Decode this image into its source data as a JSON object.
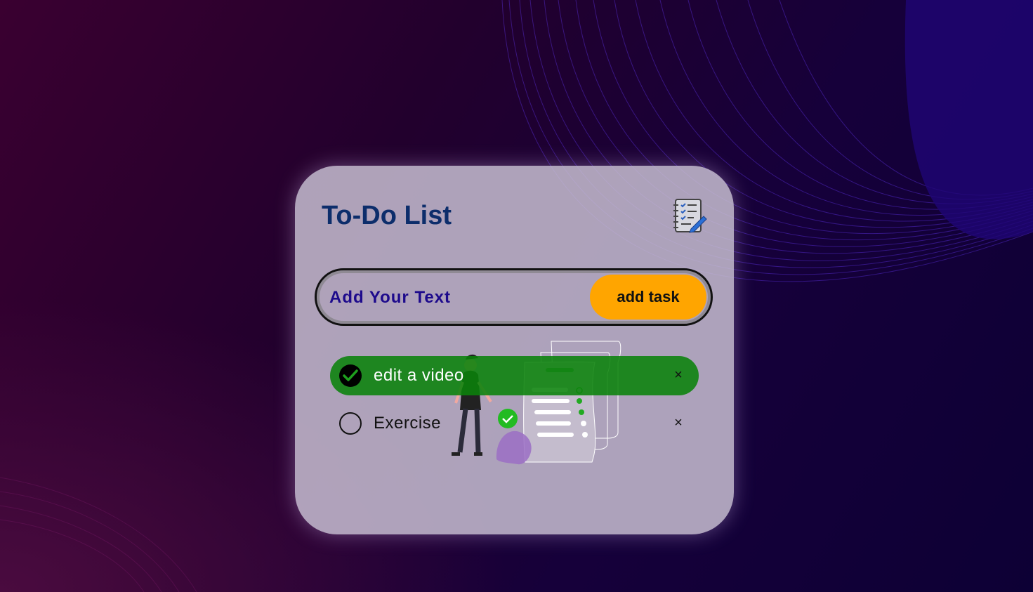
{
  "app": {
    "title": "To-Do List",
    "icon": "notebook-checklist-icon"
  },
  "input": {
    "value": "",
    "placeholder": "Add Your Text"
  },
  "add_button": {
    "label": "add task"
  },
  "tasks": [
    {
      "label": "edit a video",
      "completed": true,
      "close_symbol": "×"
    },
    {
      "label": "Exercise",
      "completed": false,
      "close_symbol": "×"
    }
  ],
  "colors": {
    "card": "#c8bed2",
    "title": "#0c2d6b",
    "accent_button": "#ffa500",
    "completed_task": "#0a820a",
    "input_text": "#1d0a8c"
  }
}
